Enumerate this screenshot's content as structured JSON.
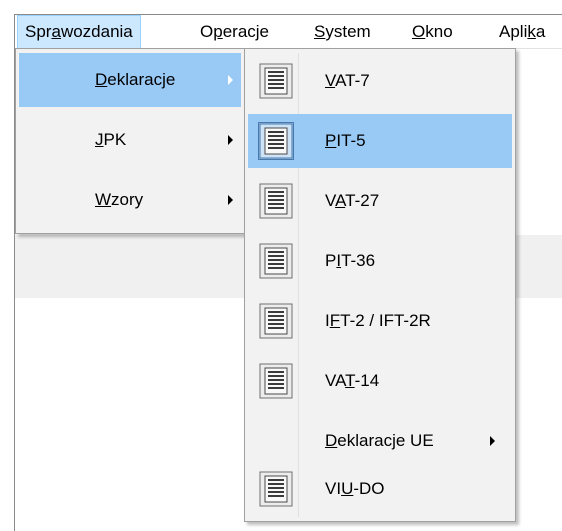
{
  "menubar": {
    "items": [
      {
        "pre": "Spr",
        "key": "a",
        "post": "wozdania"
      },
      {
        "pre": "O",
        "key": "p",
        "post": "eracje"
      },
      {
        "pre": "",
        "key": "S",
        "post": "ystem"
      },
      {
        "pre": "",
        "key": "O",
        "post": "kno"
      },
      {
        "pre": "Apli",
        "key": "k",
        "post": "a"
      }
    ]
  },
  "submenu1": {
    "items": [
      {
        "pre": "",
        "key": "D",
        "post": "eklaracje"
      },
      {
        "pre": "",
        "key": "J",
        "post": "PK"
      },
      {
        "pre": "",
        "key": "W",
        "post": "zory"
      }
    ]
  },
  "submenu2": {
    "items": [
      {
        "pre": "",
        "key": "V",
        "post": "AT-7",
        "icon": "form-icon"
      },
      {
        "pre": "",
        "key": "P",
        "post": "IT-5",
        "icon": "form-icon"
      },
      {
        "pre": "V",
        "key": "A",
        "post": "T-27",
        "icon": "form-icon"
      },
      {
        "pre": "P",
        "key": "I",
        "post": "T-36",
        "icon": "form-icon"
      },
      {
        "pre": "I",
        "key": "F",
        "post": "T-2 / IFT-2R",
        "icon": "form-icon"
      },
      {
        "pre": "VA",
        "key": "T",
        "post": "-14",
        "icon": "form-icon"
      },
      {
        "pre": "",
        "key": "D",
        "post": "eklaracje UE",
        "icon": ""
      },
      {
        "pre": "VI",
        "key": "U",
        "post": "-DO",
        "icon": "form-icon"
      }
    ]
  },
  "colors": {
    "highlight": "#99c9f5",
    "menu_bg": "#f2f2f2",
    "menubar_active": "#cce8ff"
  }
}
